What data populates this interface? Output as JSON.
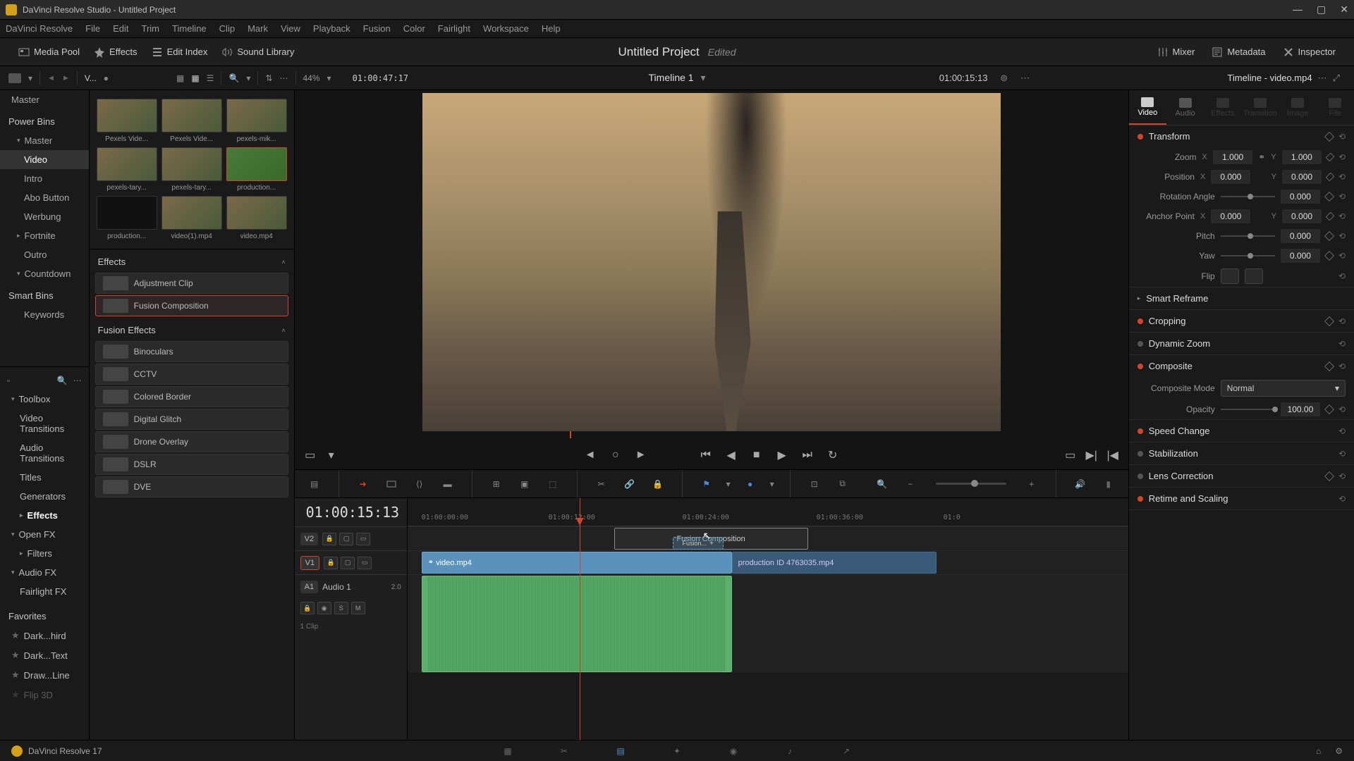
{
  "titlebar": {
    "title": "DaVinci Resolve Studio - Untitled Project"
  },
  "menu": [
    "DaVinci Resolve",
    "File",
    "Edit",
    "Trim",
    "Timeline",
    "Clip",
    "Mark",
    "View",
    "Playback",
    "Fusion",
    "Color",
    "Fairlight",
    "Workspace",
    "Help"
  ],
  "toolbar": {
    "media_pool": "Media Pool",
    "effects": "Effects",
    "edit_index": "Edit Index",
    "sound_library": "Sound Library",
    "project": "Untitled Project",
    "status": "Edited",
    "mixer": "Mixer",
    "metadata": "Metadata",
    "inspector": "Inspector"
  },
  "subtoolbar": {
    "bin_label": "V...",
    "zoom_pct": "44%",
    "timecode_source": "01:00:47:17",
    "timeline_name": "Timeline 1",
    "timecode_record": "01:00:15:13",
    "inspector_title": "Timeline - video.mp4"
  },
  "bins": {
    "master": "Master",
    "power_bins": "Power Bins",
    "pb_master": "Master",
    "video": "Video",
    "intro": "Intro",
    "abo": "Abo Button",
    "werbung": "Werbung",
    "fortnite": "Fortnite",
    "outro": "Outro",
    "countdown": "Countdown",
    "smart_bins": "Smart Bins",
    "keywords": "Keywords"
  },
  "clips": [
    {
      "name": "Pexels Vide..."
    },
    {
      "name": "Pexels Vide..."
    },
    {
      "name": "pexels-mik..."
    },
    {
      "name": "pexels-tary..."
    },
    {
      "name": "pexels-tary..."
    },
    {
      "name": "production...",
      "selected": true
    },
    {
      "name": "production..."
    },
    {
      "name": "video(1).mp4"
    },
    {
      "name": "video.mp4"
    }
  ],
  "fx_tree": {
    "toolbox": "Toolbox",
    "video_trans": "Video Transitions",
    "audio_trans": "Audio Transitions",
    "titles": "Titles",
    "generators": "Generators",
    "effects": "Effects",
    "openfx": "Open FX",
    "filters": "Filters",
    "audiofx": "Audio FX",
    "fairlight": "Fairlight FX",
    "favorites": "Favorites",
    "fav1": "Dark...hird",
    "fav2": "Dark...Text",
    "fav3": "Draw...Line",
    "fav4": "Flip 3D"
  },
  "fx_sections": {
    "effects_header": "Effects",
    "adjustment": "Adjustment Clip",
    "fusion_comp": "Fusion Composition",
    "fusion_header": "Fusion Effects",
    "binoculars": "Binoculars",
    "cctv": "CCTV",
    "colored_border": "Colored Border",
    "digital_glitch": "Digital Glitch",
    "drone": "Drone Overlay",
    "dslr": "DSLR",
    "dve": "DVE"
  },
  "timeline": {
    "tc_display": "01:00:15:13",
    "ticks": [
      "01:00:00:00",
      "01:00:12:00",
      "01:00:24:00",
      "01:00:36:00",
      "01:0"
    ],
    "v2": "V2",
    "v1": "V1",
    "a1": "A1",
    "audio1": "Audio 1",
    "audio_meta": "2.0",
    "clip_count": "1 Clip",
    "fusion_clip": "Fusion Composition",
    "fusion_drag": "Fusion...",
    "video_clip": "video.mp4",
    "prod_clip": "production ID 4763035.mp4",
    "s_btn": "S",
    "m_btn": "M"
  },
  "inspector": {
    "tabs": [
      "Video",
      "Audio",
      "Effects",
      "Transition",
      "Image",
      "File"
    ],
    "transform": "Transform",
    "zoom": "Zoom",
    "zoom_x": "1.000",
    "zoom_y": "1.000",
    "position": "Position",
    "pos_x": "0.000",
    "pos_y": "0.000",
    "rotation": "Rotation Angle",
    "rot_val": "0.000",
    "anchor": "Anchor Point",
    "anc_x": "0.000",
    "anc_y": "0.000",
    "pitch": "Pitch",
    "pitch_val": "0.000",
    "yaw": "Yaw",
    "yaw_val": "0.000",
    "flip": "Flip",
    "smart_reframe": "Smart Reframe",
    "cropping": "Cropping",
    "dynamic_zoom": "Dynamic Zoom",
    "composite": "Composite",
    "comp_mode": "Composite Mode",
    "comp_mode_val": "Normal",
    "opacity": "Opacity",
    "opacity_val": "100.00",
    "speed": "Speed Change",
    "stabilization": "Stabilization",
    "lens": "Lens Correction",
    "retime": "Retime and Scaling",
    "x_label": "X",
    "y_label": "Y"
  },
  "bottombar": {
    "version": "DaVinci Resolve 17"
  }
}
